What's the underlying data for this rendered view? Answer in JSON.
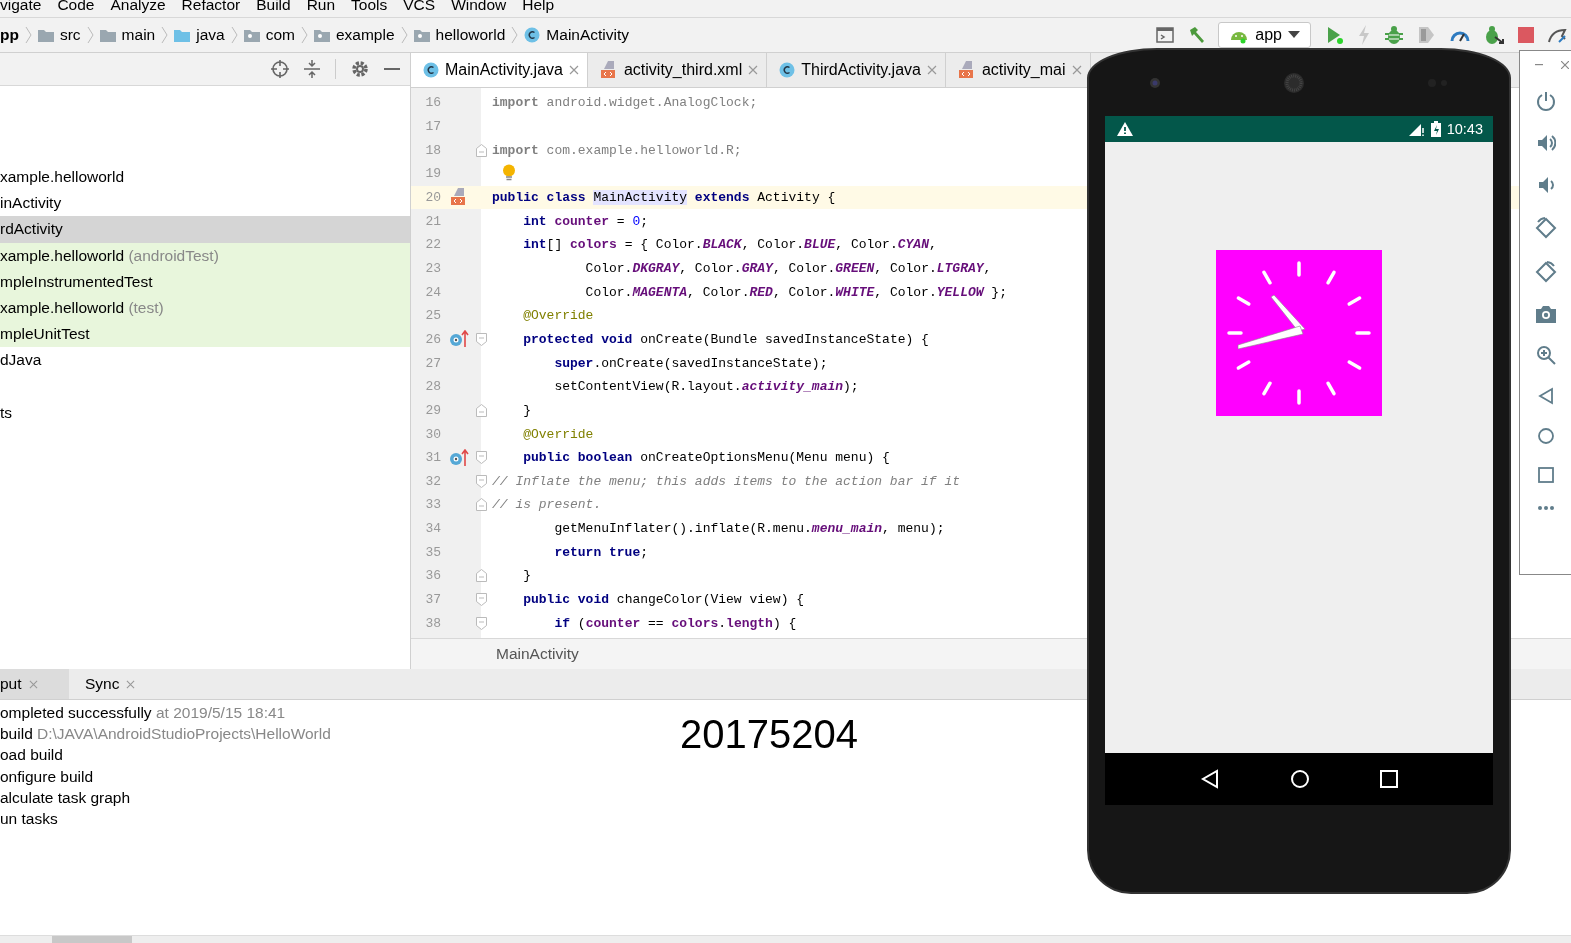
{
  "menu": [
    "vigate",
    "Code",
    "Analyze",
    "Refactor",
    "Build",
    "Run",
    "Tools",
    "VCS",
    "Window",
    "Help"
  ],
  "breadcrumb": [
    {
      "label": "pp",
      "kind": "module"
    },
    {
      "label": "src",
      "kind": "folder"
    },
    {
      "label": "main",
      "kind": "folder"
    },
    {
      "label": "java",
      "kind": "source"
    },
    {
      "label": "com",
      "kind": "package"
    },
    {
      "label": "example",
      "kind": "package"
    },
    {
      "label": "helloworld",
      "kind": "package"
    },
    {
      "label": "MainActivity",
      "kind": "class"
    }
  ],
  "run_config": "app",
  "project_tree": [
    {
      "label": "xample.helloworld",
      "selected": false,
      "test_scope": false
    },
    {
      "label": "inActivity",
      "selected": false,
      "test_scope": false
    },
    {
      "label": "rdActivity",
      "selected": true,
      "test_scope": false
    },
    {
      "label": "xample.helloworld",
      "suffix": "(androidTest)",
      "selected": false,
      "test_scope": true
    },
    {
      "label": "mpleInstrumentedTest",
      "selected": false,
      "test_scope": true
    },
    {
      "label": "xample.helloworld",
      "suffix": "(test)",
      "selected": false,
      "test_scope": true
    },
    {
      "label": "mpleUnitTest",
      "selected": false,
      "test_scope": true
    },
    {
      "label": "dJava",
      "selected": false,
      "test_scope": false
    },
    {
      "label": "ts",
      "selected": false,
      "test_scope": false
    }
  ],
  "editor_tabs": [
    {
      "label": "MainActivity.java",
      "kind": "class",
      "selected": true
    },
    {
      "label": "activity_third.xml",
      "kind": "layout",
      "selected": false
    },
    {
      "label": "ThirdActivity.java",
      "kind": "class",
      "selected": false
    },
    {
      "label": "activity_mai",
      "kind": "layout",
      "selected": false
    }
  ],
  "code_lines": [
    {
      "number": "16",
      "tokens": [
        {
          "kind": "keyword_unused",
          "text": "import"
        },
        {
          "kind": "unused",
          "text": " android.widget.AnalogClock;"
        }
      ]
    },
    {
      "number": "17"
    },
    {
      "number": "18",
      "fold_end": true,
      "tokens": [
        {
          "kind": "keyword_unused",
          "text": "import"
        },
        {
          "kind": "unused",
          "text": " com.example.helloworld.R;"
        }
      ]
    },
    {
      "number": "19",
      "has_bulb": true
    },
    {
      "number": "20",
      "current": true,
      "layout_marker": true,
      "tokens": [
        {
          "kind": "keyword",
          "text": "public class "
        },
        {
          "kind": "highlight",
          "text": "MainActivity"
        },
        {
          "kind": "keyword",
          "text": " extends"
        },
        {
          "kind": "plain",
          "text": " Activity {"
        }
      ]
    },
    {
      "number": "21",
      "tokens": [
        {
          "kind": "keyword",
          "text": "    int"
        },
        {
          "kind": "field",
          "text": " counter"
        },
        {
          "kind": "plain",
          "text": " = "
        },
        {
          "kind": "number",
          "text": "0"
        },
        {
          "kind": "plain",
          "text": ";"
        }
      ]
    },
    {
      "number": "22",
      "tokens": [
        {
          "kind": "keyword",
          "text": "    int"
        },
        {
          "kind": "plain",
          "text": "[] "
        },
        {
          "kind": "field",
          "text": "colors"
        },
        {
          "kind": "plain",
          "text": " = { Color."
        },
        {
          "kind": "constant",
          "text": "BLACK"
        },
        {
          "kind": "plain",
          "text": ", Color."
        },
        {
          "kind": "constant",
          "text": "BLUE"
        },
        {
          "kind": "plain",
          "text": ", Color."
        },
        {
          "kind": "constant",
          "text": "CYAN"
        },
        {
          "kind": "plain",
          "text": ","
        }
      ]
    },
    {
      "number": "23",
      "tokens": [
        {
          "kind": "plain",
          "text": "            Color."
        },
        {
          "kind": "constant",
          "text": "DKGRAY"
        },
        {
          "kind": "plain",
          "text": ", Color."
        },
        {
          "kind": "constant",
          "text": "GRAY"
        },
        {
          "kind": "plain",
          "text": ", Color."
        },
        {
          "kind": "constant",
          "text": "GREEN"
        },
        {
          "kind": "plain",
          "text": ", Color."
        },
        {
          "kind": "constant",
          "text": "LTGRAY"
        },
        {
          "kind": "plain",
          "text": ","
        }
      ]
    },
    {
      "number": "24",
      "tokens": [
        {
          "kind": "plain",
          "text": "            Color."
        },
        {
          "kind": "constant",
          "text": "MAGENTA"
        },
        {
          "kind": "plain",
          "text": ", Color."
        },
        {
          "kind": "constant",
          "text": "RED"
        },
        {
          "kind": "plain",
          "text": ", Color."
        },
        {
          "kind": "constant",
          "text": "WHITE"
        },
        {
          "kind": "plain",
          "text": ", Color."
        },
        {
          "kind": "constant",
          "text": "YELLOW"
        },
        {
          "kind": "plain",
          "text": " };"
        }
      ]
    },
    {
      "number": "25",
      "tokens": [
        {
          "kind": "annotation",
          "text": "    @Override"
        }
      ]
    },
    {
      "number": "26",
      "override_marker": true,
      "fold_start": true,
      "tokens": [
        {
          "kind": "keyword",
          "text": "    protected void"
        },
        {
          "kind": "plain",
          "text": " onCreate(Bundle savedInstanceState) {"
        }
      ]
    },
    {
      "number": "27",
      "tokens": [
        {
          "kind": "keyword",
          "text": "        super"
        },
        {
          "kind": "plain",
          "text": ".onCreate(savedInstanceState);"
        }
      ]
    },
    {
      "number": "28",
      "tokens": [
        {
          "kind": "plain",
          "text": "        setContentView(R.layout."
        },
        {
          "kind": "constant",
          "text": "activity_main"
        },
        {
          "kind": "plain",
          "text": ");"
        }
      ]
    },
    {
      "number": "29",
      "fold_end": true,
      "tokens": [
        {
          "kind": "plain",
          "text": "    }"
        }
      ]
    },
    {
      "number": "30",
      "tokens": [
        {
          "kind": "annotation",
          "text": "    @Override"
        }
      ]
    },
    {
      "number": "31",
      "override_marker": true,
      "fold_start": true,
      "tokens": [
        {
          "kind": "keyword",
          "text": "    public boolean"
        },
        {
          "kind": "plain",
          "text": " onCreateOptionsMenu(Menu menu) {"
        }
      ]
    },
    {
      "number": "32",
      "fold_start": true,
      "tokens": [
        {
          "kind": "comment",
          "text": "// Inflate the menu; this adds items to the action bar if it"
        }
      ]
    },
    {
      "number": "33",
      "fold_end": true,
      "tokens": [
        {
          "kind": "comment",
          "text": "// is present."
        }
      ]
    },
    {
      "number": "34",
      "tokens": [
        {
          "kind": "plain",
          "text": "        getMenuInflater().inflate(R.menu."
        },
        {
          "kind": "constant",
          "text": "menu_main"
        },
        {
          "kind": "plain",
          "text": ", menu);"
        }
      ]
    },
    {
      "number": "35",
      "tokens": [
        {
          "kind": "keyword",
          "text": "        return true"
        },
        {
          "kind": "plain",
          "text": ";"
        }
      ]
    },
    {
      "number": "36",
      "fold_end": true,
      "tokens": [
        {
          "kind": "plain",
          "text": "    }"
        }
      ]
    },
    {
      "number": "37",
      "fold_start": true,
      "tokens": [
        {
          "kind": "keyword",
          "text": "    public void"
        },
        {
          "kind": "plain",
          "text": " changeColor(View view) {"
        }
      ]
    },
    {
      "number": "38",
      "fold_start": true,
      "tokens": [
        {
          "kind": "keyword",
          "text": "        if"
        },
        {
          "kind": "plain",
          "text": " ("
        },
        {
          "kind": "field",
          "text": "counter"
        },
        {
          "kind": "plain",
          "text": " == "
        },
        {
          "kind": "field",
          "text": "colors"
        },
        {
          "kind": "plain",
          "text": "."
        },
        {
          "kind": "field",
          "text": "length"
        },
        {
          "kind": "plain",
          "text": ") {"
        }
      ]
    }
  ],
  "editor_breadcrumb": "MainActivity",
  "bottom_tabs": [
    {
      "label": "put",
      "selected": true
    },
    {
      "label": "Sync",
      "selected": false
    }
  ],
  "build_output": [
    {
      "text": "ompleted successfully",
      "detail": "at 2019/5/15 18:41"
    },
    {
      "text": "build",
      "detail": "D:\\JAVA\\AndroidStudioProjects\\HelloWorld"
    },
    {
      "text": "oad build"
    },
    {
      "text": "onfigure build"
    },
    {
      "text": "alculate task graph"
    },
    {
      "text": "un tasks"
    }
  ],
  "floating_text": "20175204",
  "emulator": {
    "status_time": "10:43"
  }
}
